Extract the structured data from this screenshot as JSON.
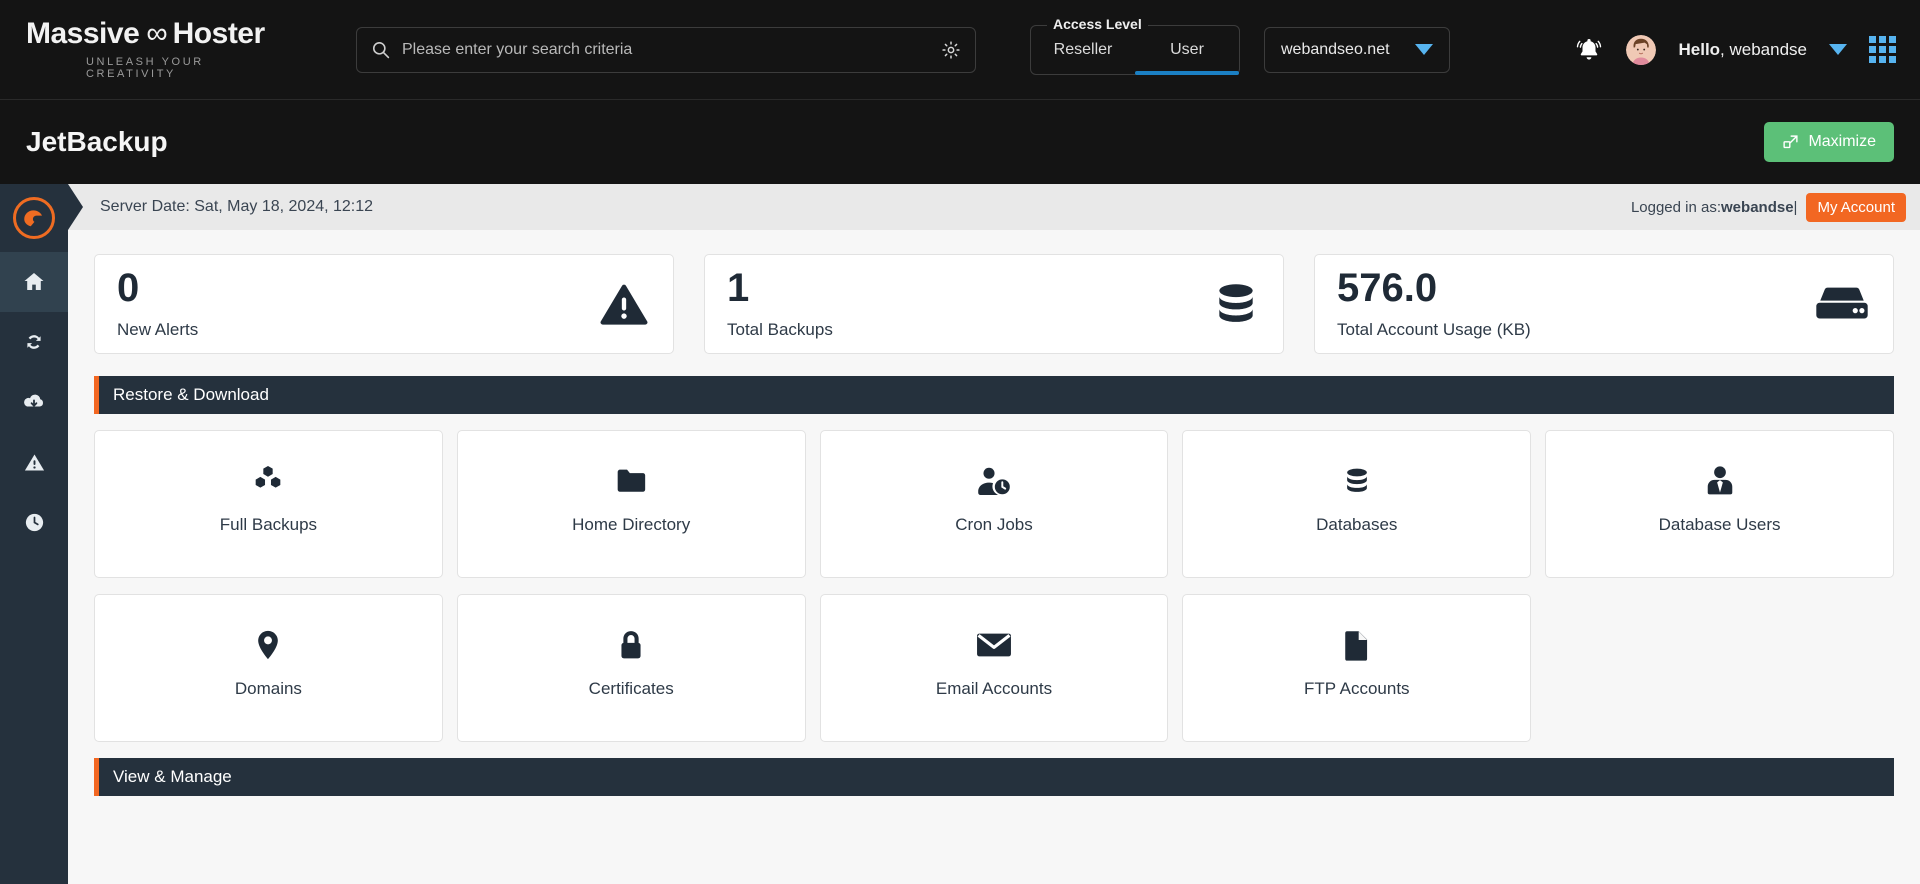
{
  "header": {
    "brand": {
      "name_left": "Massive",
      "infinity": "∞",
      "name_right": "Hoster",
      "tagline": "UNLEASH YOUR CREATIVITY"
    },
    "search": {
      "placeholder": "Please enter your search criteria",
      "value": "",
      "icon": "search-icon",
      "settings_icon": "gear-icon"
    },
    "access_level": {
      "legend": "Access Level",
      "tabs": [
        {
          "label": "Reseller",
          "active": false
        },
        {
          "label": "User",
          "active": true
        }
      ],
      "active_color": "#1b80c4"
    },
    "domain_select": {
      "value": "webandseo.net",
      "caret_icon": "caret-down-icon"
    },
    "notifications_icon": "bell-icon",
    "avatar_icon": "user-avatar",
    "greeting_prefix": "Hello",
    "greeting_user": ", webandse",
    "user_caret_icon": "caret-down-icon",
    "apps_icon": "apps-grid-icon"
  },
  "page": {
    "title": "JetBackup",
    "maximize_label": "Maximize",
    "maximize_icon": "expand-icon",
    "maximize_color": "#5cc078"
  },
  "sidebar": {
    "logo_icon": "jetbackup-logo-icon",
    "accent_color": "#ef6c22",
    "items": [
      {
        "name": "home",
        "icon": "home-icon",
        "active": true
      },
      {
        "name": "restore",
        "icon": "sync-icon",
        "active": false
      },
      {
        "name": "downloads",
        "icon": "cloud-download-icon",
        "active": false
      },
      {
        "name": "alerts",
        "icon": "alert-triangle-icon",
        "active": false
      },
      {
        "name": "queue",
        "icon": "clock-icon",
        "active": false
      }
    ]
  },
  "statusbar": {
    "server_date": "Server Date: Sat, May 18, 2024, 12:12",
    "logged_in_prefix": "Logged in as: ",
    "logged_in_user": "webandse",
    "separator": " | ",
    "my_account_label": "My Account",
    "my_account_color": "#f26722"
  },
  "stats": [
    {
      "value": "0",
      "label": "New Alerts",
      "icon": "warning-triangle-icon"
    },
    {
      "value": "1",
      "label": "Total Backups",
      "icon": "database-icon"
    },
    {
      "value": "576.0",
      "label": "Total Account Usage (KB)",
      "icon": "hard-drive-icon"
    }
  ],
  "sections": [
    {
      "title": "Restore & Download",
      "tiles_row1": [
        {
          "label": "Full Backups",
          "icon": "cubes-icon"
        },
        {
          "label": "Home Directory",
          "icon": "folder-icon"
        },
        {
          "label": "Cron Jobs",
          "icon": "user-clock-icon"
        },
        {
          "label": "Databases",
          "icon": "database-icon"
        },
        {
          "label": "Database Users",
          "icon": "user-tie-icon"
        }
      ],
      "tiles_row2": [
        {
          "label": "Domains",
          "icon": "map-pin-icon"
        },
        {
          "label": "Certificates",
          "icon": "lock-icon"
        },
        {
          "label": "Email Accounts",
          "icon": "envelope-icon"
        },
        {
          "label": "FTP Accounts",
          "icon": "file-icon"
        }
      ]
    },
    {
      "title": "View & Manage"
    }
  ]
}
